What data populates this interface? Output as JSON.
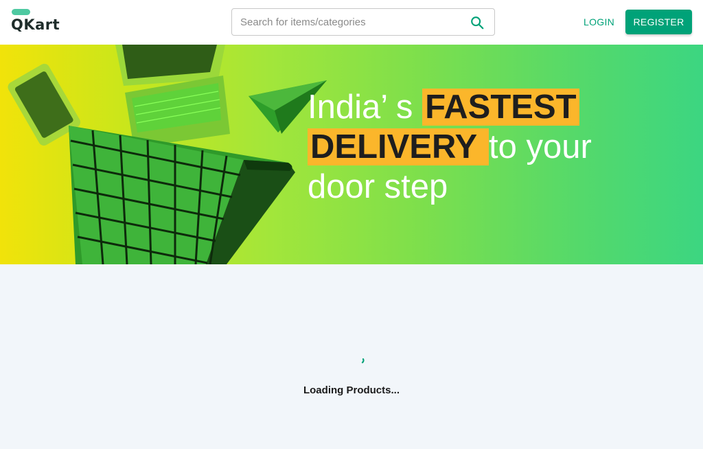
{
  "header": {
    "logo_text": "QKart",
    "search": {
      "placeholder": "Search for items/categories",
      "value": ""
    },
    "login_label": "LOGIN",
    "register_label": "REGISTER"
  },
  "hero": {
    "line1_plain": "India’ s ",
    "line1_highlight": "FASTEST",
    "line2_highlight": "DELIVERY ",
    "line2_plain": "to your",
    "line3_plain": "door step"
  },
  "content": {
    "loading_text": "Loading Products..."
  },
  "colors": {
    "brand": "#00a278",
    "logo_accent": "#4ec9a1",
    "highlight": "#fbb62b",
    "page_bg": "#f2f6fa"
  },
  "icons": {
    "search": "search-icon",
    "spinner": "loading-spinner-icon"
  }
}
